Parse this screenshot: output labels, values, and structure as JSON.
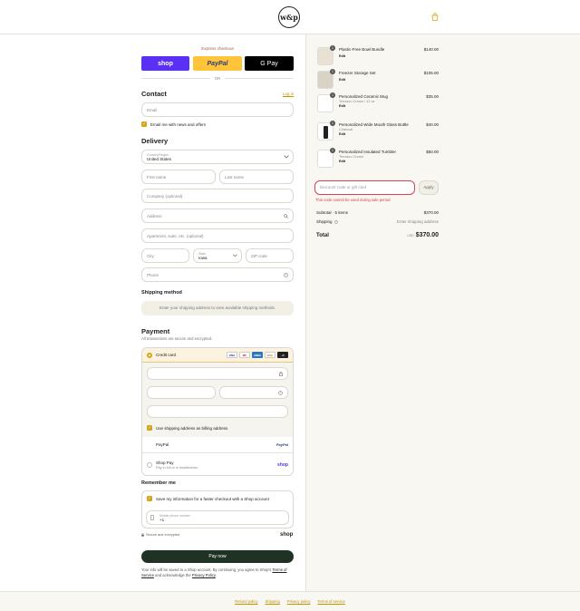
{
  "header": {
    "logo_text": "w&p"
  },
  "express": {
    "label": "Express checkout",
    "shop_label": "shop",
    "paypal_label": "PayPal",
    "gpay_label": "G Pay",
    "or_label": "OR",
    "colors": {
      "shop": "#5a31f4",
      "paypal": "#ffc439",
      "gpay": "#000000"
    }
  },
  "contact": {
    "title": "Contact",
    "login_label": "Log in",
    "email_placeholder": "Email",
    "news_label": "Email me with news and offers"
  },
  "delivery": {
    "title": "Delivery",
    "country_label": "Country/Region",
    "country_value": "United States",
    "first_name_placeholder": "First name",
    "last_name_placeholder": "Last name",
    "company_placeholder": "Company (optional)",
    "address_placeholder": "Address",
    "apartment_placeholder": "Apartment, suite, etc. (optional)",
    "city_placeholder": "City",
    "state_label": "State",
    "state_value": "Iowa",
    "zip_placeholder": "ZIP code",
    "phone_placeholder": "Phone"
  },
  "shipping": {
    "title": "Shipping method",
    "note": "Enter your shipping address to view available shipping methods."
  },
  "payment": {
    "title": "Payment",
    "subtitle": "All transactions are secure and encrypted.",
    "credit_card_label": "Credit card",
    "card_logos": [
      "VISA",
      "MC",
      "AMEX",
      "DISC",
      "+5"
    ],
    "billing_label": "Use shipping address as billing address",
    "paypal_label": "PayPal",
    "paypal_logo": "PayPal",
    "shoppay_label": "Shop Pay",
    "shoppay_sub": "Pay in full or in installments",
    "shoppay_logo": "shop"
  },
  "remember": {
    "title": "Remember me",
    "save_label": "Save my information for a faster checkout with a Shop account",
    "phone_label": "Mobile phone number",
    "phone_value": "+1",
    "secure_label": "Secure and encrypted",
    "shop_logo": "shop"
  },
  "paynow_label": "Pay now",
  "legal": {
    "text": "Your info will be saved to a Shop account. By continuing, you agree to Shop's",
    "tos": "Terms of Service",
    "and": "and acknowledge the",
    "privacy": "Privacy Policy",
    "end": "."
  },
  "cart": {
    "items": [
      {
        "name": "Plastic-Free Bowl Bundle",
        "variant": "",
        "edit": "Edit",
        "price": "$140.00",
        "qty": "1"
      },
      {
        "name": "Freezer Storage Set",
        "variant": "",
        "edit": "Edit",
        "price": "$105.00",
        "qty": "1"
      },
      {
        "name": "Personalized Ceramic Mug",
        "variant": "Terrazzo Cream / 12 oz",
        "edit": "Edit",
        "price": "$35.00",
        "qty": "1"
      },
      {
        "name": "Personalized Wide Mouth Glass Bottle",
        "variant": "Charcoal",
        "edit": "Edit",
        "price": "$40.00",
        "qty": "1"
      },
      {
        "name": "Personalized Insulated Tumbler",
        "variant": "Terrazzo Cream",
        "edit": "Edit",
        "price": "$50.00",
        "qty": "1"
      }
    ],
    "discount_placeholder": "Discount code or gift card",
    "apply_label": "Apply",
    "error": "This code cannot be used during sale period",
    "subtotal_label": "Subtotal · 5 items",
    "subtotal_value": "$370.00",
    "shipping_label": "Shipping",
    "shipping_value": "Enter shipping address",
    "total_label": "Total",
    "total_currency": "USD",
    "total_value": "$370.00"
  },
  "footer": {
    "links": [
      "Refund policy",
      "Shipping",
      "Privacy policy",
      "Terms of service"
    ]
  }
}
